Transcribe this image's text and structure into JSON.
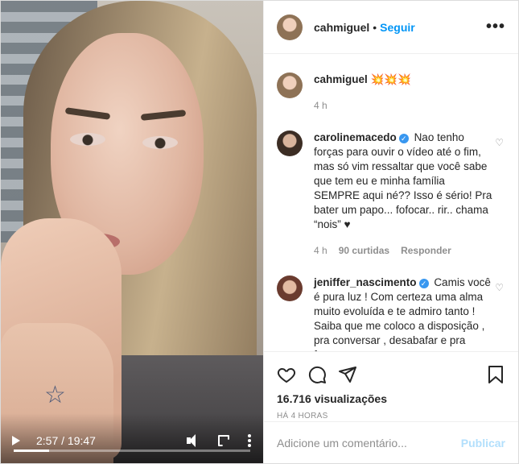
{
  "header": {
    "username": "cahmiguel",
    "separator": "•",
    "follow_label": "Seguir",
    "more_icon": "more-horizontal-icon"
  },
  "video": {
    "time_current": "2:57",
    "time_total": "19:47",
    "time_display": "2:57 / 19:47",
    "progress": 0.149,
    "icons": [
      "play-icon",
      "volume-icon",
      "fullscreen-icon",
      "more-vertical-icon"
    ]
  },
  "caption": {
    "username": "cahmiguel",
    "text": "💥💥💥",
    "time": "4 h"
  },
  "comments": [
    {
      "username": "carolinemacedo",
      "verified": true,
      "text": "Nao tenho forças para ouvir o vídeo até o fim, mas só vim ressaltar que você sabe que tem eu e minha família SEMPRE aqui né?? Isso é sério! Pra bater um papo... fofocar.. rir.. chama “nois” ♥",
      "time": "4 h",
      "likes": "90 curtidas",
      "reply_label": "Responder"
    },
    {
      "username": "jeniffer_nascimento",
      "verified": true,
      "text": "Camis você é pura luz ! Com certeza uma alma muito evoluída e te admiro tanto ! Saiba que me coloco a disposição , pra conversar , desabafar e pra fazer"
    }
  ],
  "actions": {
    "icons": [
      "heart-icon",
      "comment-icon",
      "share-icon",
      "bookmark-icon"
    ],
    "views": "16.716 visualizações",
    "posted": "HÁ 4 HORAS"
  },
  "add_comment": {
    "placeholder": "Adicione um comentário...",
    "post_label": "Publicar"
  },
  "colors": {
    "link_blue": "#0095f6",
    "muted_text": "#8e8e8e",
    "disabled_blue": "#b2dffc"
  }
}
